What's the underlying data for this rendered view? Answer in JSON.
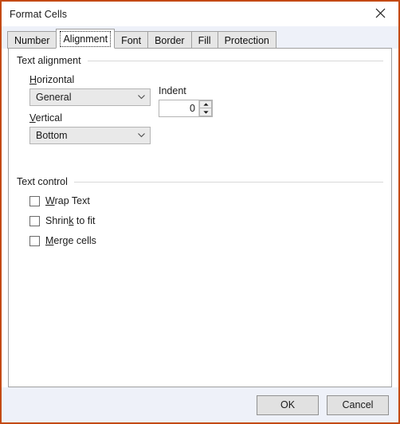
{
  "window": {
    "title": "Format Cells",
    "close_icon": "close-icon",
    "border_color": "#c44a14"
  },
  "tabs": [
    {
      "label": "Number",
      "active": false
    },
    {
      "label": "Alignment",
      "active": true
    },
    {
      "label": "Font",
      "active": false
    },
    {
      "label": "Border",
      "active": false
    },
    {
      "label": "Fill",
      "active": false
    },
    {
      "label": "Protection",
      "active": false
    }
  ],
  "text_alignment": {
    "group_title": "Text alignment",
    "horizontal": {
      "label_accel": "H",
      "label_rest": "orizontal",
      "value": "General",
      "arrow_icon": "chevron-down-icon"
    },
    "vertical": {
      "label_accel": "V",
      "label_rest": "ertical",
      "value": "Bottom",
      "arrow_icon": "chevron-down-icon"
    },
    "indent": {
      "label": "Indent",
      "value": "0",
      "up_icon": "spinner-up-icon",
      "down_icon": "spinner-down-icon"
    }
  },
  "text_control": {
    "group_title": "Text control",
    "options": [
      {
        "pre": "",
        "accel": "W",
        "post": "rap Text",
        "checked": false
      },
      {
        "pre": "Shrin",
        "accel": "k",
        "post": " to fit",
        "checked": false
      },
      {
        "pre": "",
        "accel": "M",
        "post": "erge cells",
        "checked": false
      }
    ]
  },
  "footer": {
    "ok_label": "OK",
    "cancel_label": "Cancel"
  }
}
